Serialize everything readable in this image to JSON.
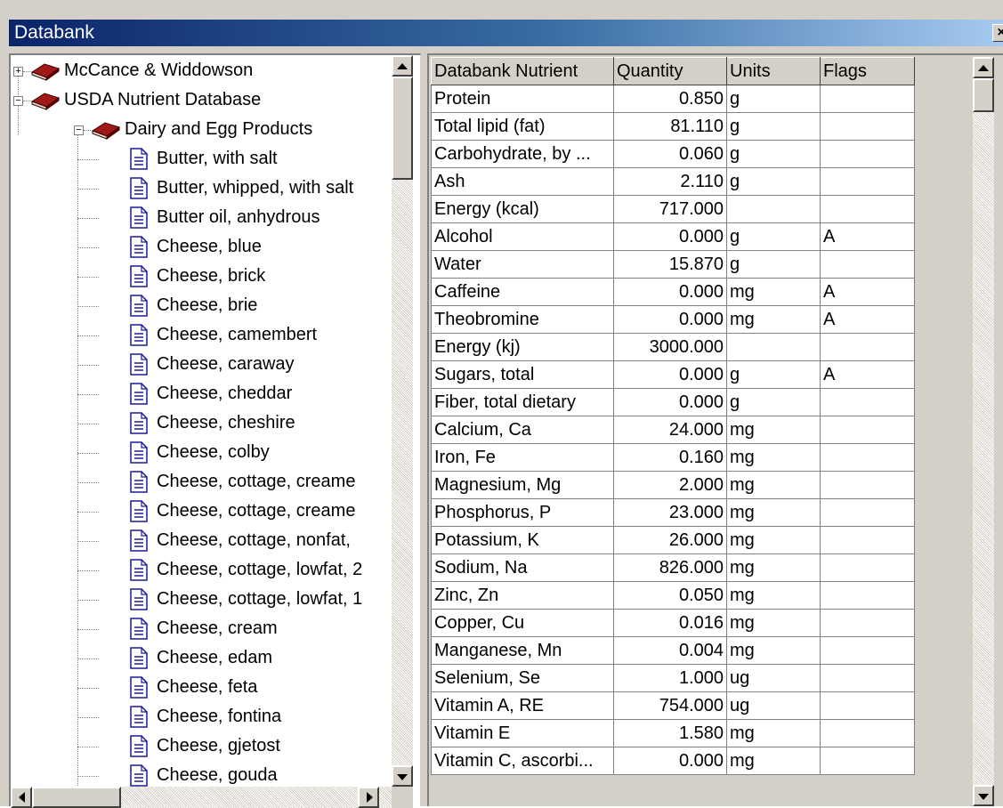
{
  "window": {
    "title": "Databank"
  },
  "tree": {
    "databases": [
      {
        "label": "McCance & Widdowson",
        "expander": "+"
      },
      {
        "label": "USDA Nutrient Database",
        "expander": "−"
      }
    ],
    "group": {
      "label": "Dairy and Egg Products",
      "expander": "−"
    },
    "foods": [
      "Butter, with salt",
      "Butter, whipped, with salt",
      "Butter oil, anhydrous",
      "Cheese, blue",
      "Cheese, brick",
      "Cheese, brie",
      "Cheese, camembert",
      "Cheese, caraway",
      "Cheese, cheddar",
      "Cheese, cheshire",
      "Cheese, colby",
      "Cheese, cottage, creame",
      "Cheese, cottage, creame",
      "Cheese, cottage, nonfat,",
      "Cheese, cottage, lowfat, 2",
      "Cheese, cottage, lowfat, 1",
      "Cheese, cream",
      "Cheese, edam",
      "Cheese, feta",
      "Cheese, fontina",
      "Cheese, gjetost",
      "Cheese, gouda"
    ]
  },
  "grid": {
    "columns": [
      "Databank Nutrient",
      "Quantity",
      "Units",
      "Flags"
    ],
    "rows": [
      [
        "Protein",
        "0.850",
        "g",
        ""
      ],
      [
        "Total lipid (fat)",
        "81.110",
        "g",
        ""
      ],
      [
        "Carbohydrate, by ...",
        "0.060",
        "g",
        ""
      ],
      [
        "Ash",
        "2.110",
        "g",
        ""
      ],
      [
        "Energy (kcal)",
        "717.000",
        "",
        ""
      ],
      [
        "Alcohol",
        "0.000",
        "g",
        "A"
      ],
      [
        "Water",
        "15.870",
        "g",
        ""
      ],
      [
        "Caffeine",
        "0.000",
        "mg",
        "A"
      ],
      [
        "Theobromine",
        "0.000",
        "mg",
        "A"
      ],
      [
        "Energy (kj)",
        "3000.000",
        "",
        ""
      ],
      [
        "Sugars, total",
        "0.000",
        "g",
        "A"
      ],
      [
        "Fiber, total dietary",
        "0.000",
        "g",
        ""
      ],
      [
        "Calcium, Ca",
        "24.000",
        "mg",
        ""
      ],
      [
        "Iron, Fe",
        "0.160",
        "mg",
        ""
      ],
      [
        "Magnesium, Mg",
        "2.000",
        "mg",
        ""
      ],
      [
        "Phosphorus, P",
        "23.000",
        "mg",
        ""
      ],
      [
        "Potassium, K",
        "26.000",
        "mg",
        ""
      ],
      [
        "Sodium, Na",
        "826.000",
        "mg",
        ""
      ],
      [
        "Zinc, Zn",
        "0.050",
        "mg",
        ""
      ],
      [
        "Copper, Cu",
        "0.016",
        "mg",
        ""
      ],
      [
        "Manganese, Mn",
        "0.004",
        "mg",
        ""
      ],
      [
        "Selenium, Se",
        "1.000",
        "ug",
        ""
      ],
      [
        "Vitamin A, RE",
        "754.000",
        "ug",
        ""
      ],
      [
        "Vitamin E",
        "1.580",
        "mg",
        ""
      ],
      [
        "Vitamin C, ascorbi...",
        "0.000",
        "mg",
        ""
      ]
    ]
  },
  "colors": {
    "titlebar_start": "#0a246a",
    "titlebar_end": "#a6caf0",
    "chrome": "#d4d0c8"
  },
  "icons": {
    "database": "book-icon",
    "group": "book-icon",
    "food": "document-icon",
    "close": "close-icon"
  }
}
